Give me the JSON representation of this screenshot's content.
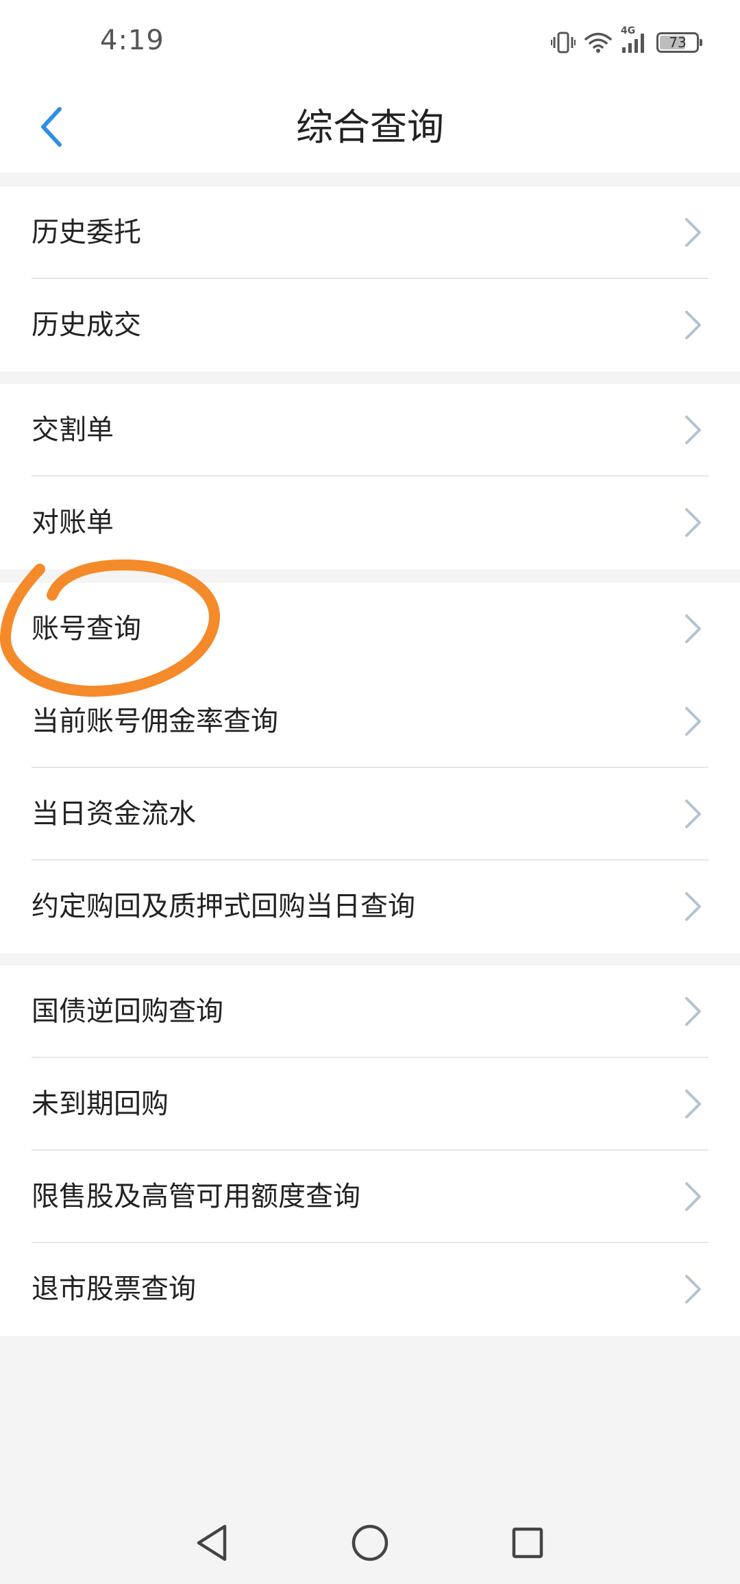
{
  "status_bar": {
    "time": "4:19",
    "network": "4G",
    "battery_level": "73",
    "battery_fraction": 0.73,
    "icons": [
      "vibrate-icon",
      "wifi-icon",
      "signal-icon",
      "battery-icon"
    ]
  },
  "header": {
    "title": "综合查询",
    "back_icon": "chevron-left-icon"
  },
  "colors": {
    "accent": "#2f8fe6",
    "chevron": "#b3c3d4",
    "annotation": "#f58a2a",
    "divider": "#e6e6e6",
    "background": "#f4f4f4"
  },
  "groups": [
    {
      "items": [
        {
          "label": "历史委托"
        },
        {
          "label": "历史成交"
        }
      ]
    },
    {
      "items": [
        {
          "label": "交割单"
        },
        {
          "label": "对账单"
        }
      ]
    },
    {
      "items": [
        {
          "label": "账号查询"
        },
        {
          "label": "当前账号佣金率查询"
        },
        {
          "label": "当日资金流水"
        },
        {
          "label": "约定购回及质押式回购当日查询"
        }
      ]
    },
    {
      "items": [
        {
          "label": "国债逆回购查询"
        },
        {
          "label": "未到期回购"
        },
        {
          "label": "限售股及高管可用额度查询"
        },
        {
          "label": "退市股票查询"
        }
      ]
    }
  ],
  "bottom_nav": {
    "icons": [
      "back-triangle-icon",
      "home-circle-icon",
      "recents-square-icon"
    ]
  }
}
